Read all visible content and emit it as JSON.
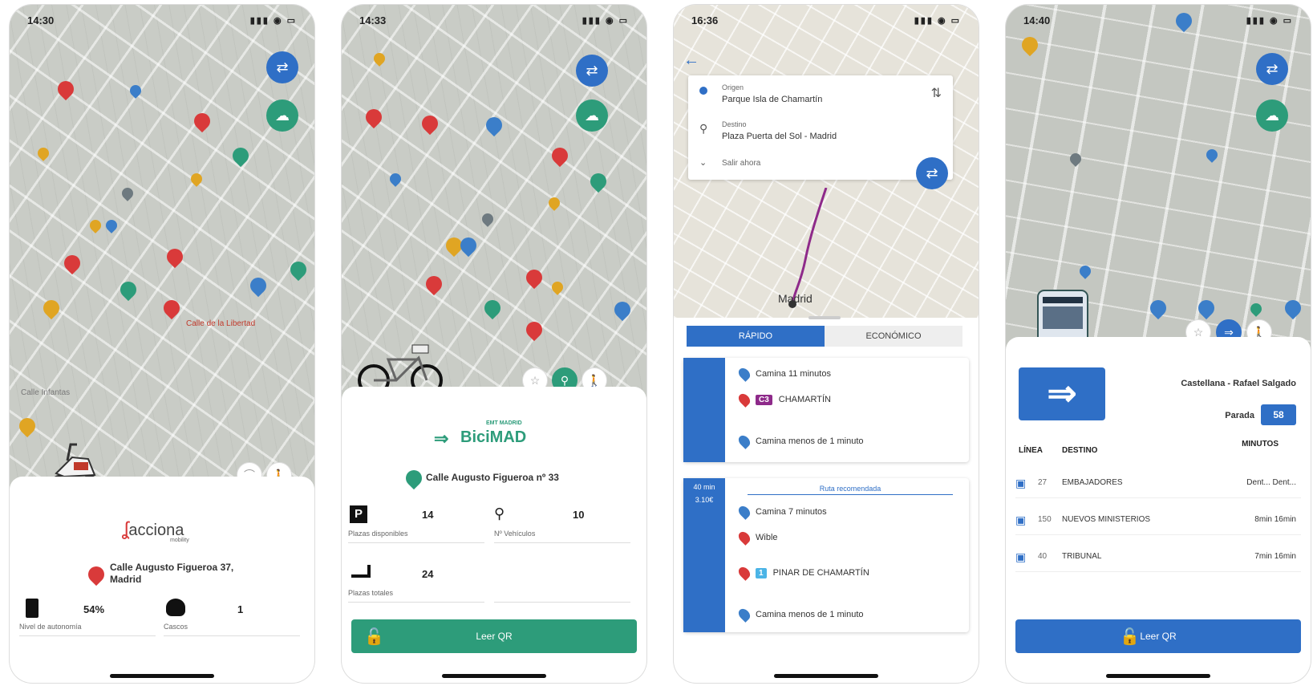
{
  "screens": [
    {
      "time": "14:30",
      "brand": "acciona",
      "brand_sub": "mobility",
      "address": "Calle Augusto Figueroa 37, Madrid",
      "battery_value": "54%",
      "battery_label": "Nivel de autonomía",
      "helmet_value": "1",
      "helmet_label": "Cascos",
      "map_label": "Calle de la Libertad",
      "map_street": "Calle Infantas"
    },
    {
      "time": "14:33",
      "brand_top": "EMT MADRID",
      "brand": "BiciMAD",
      "address": "Calle Augusto Figueroa nº 33",
      "parking_value": "14",
      "parking_label": "Plazas disponibles",
      "bikes_value": "10",
      "bikes_label": "Nº Vehículos",
      "total_value": "24",
      "total_label": "Plazas totales",
      "cta": "Leer QR"
    },
    {
      "time": "16:36",
      "origin_label": "Origen",
      "origin_value": "Parque Isla de Chamartín",
      "dest_label": "Destino",
      "dest_value": "Plaza Puerta del Sol - Madrid",
      "depart": "Salir ahora",
      "tab_fast": "RÁPIDO",
      "tab_cheap": "ECONÓMICO",
      "map_city": "Madrid",
      "route1": {
        "walk1": "Camina 11 minutos",
        "line": "C3",
        "stop": "CHAMARTÍN",
        "walk2": "Camina menos de 1 minuto"
      },
      "route2": {
        "duration": "40 min",
        "price": "3.10€",
        "heading": "Ruta recomendada",
        "walk1": "Camina 7 minutos",
        "bike": "Wible",
        "line": "1",
        "stop": "PINAR DE CHAMARTÍN",
        "walk2": "Camina menos de 1 minuto"
      }
    },
    {
      "time": "14:40",
      "stop_name": "Castellana - Rafael Salgado",
      "stop_label": "Parada",
      "stop_number": "58",
      "col_line": "LÍNEA",
      "col_dest": "DESTINO",
      "col_min": "MINUTOS",
      "rows": [
        {
          "line": "27",
          "dest": "EMBAJADORES",
          "min": "Dent... Dent..."
        },
        {
          "line": "150",
          "dest": "NUEVOS MINISTERIOS",
          "min": "8min  16min"
        },
        {
          "line": "40",
          "dest": "TRIBUNAL",
          "min": "7min  16min"
        }
      ],
      "cta": "Leer QR"
    }
  ],
  "colors": {
    "blue": "#2f6fc6",
    "green": "#2d9c7a",
    "red": "#d93a3a",
    "yellow": "#e0a523"
  }
}
